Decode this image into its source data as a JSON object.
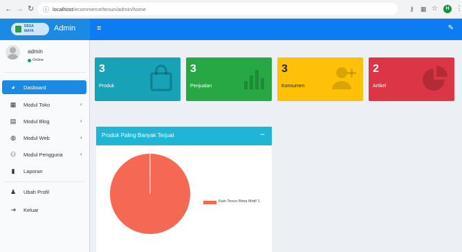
{
  "browser": {
    "url_host": "localhost",
    "url_path": "/ecommerce/tenun/admin/home",
    "profile_initial": "H"
  },
  "brand": {
    "logo_line1": "DESA",
    "logo_line2": "MAYA",
    "name": "Admin"
  },
  "user": {
    "name": "admin",
    "status": "Online"
  },
  "sidebar": {
    "items": [
      {
        "label": "Dasboard",
        "icon": "dashboard-icon"
      },
      {
        "label": "Modul Toko",
        "icon": "grid-icon"
      },
      {
        "label": "Modul Blog",
        "icon": "newspaper-icon"
      },
      {
        "label": "Modul Web",
        "icon": "globe-icon"
      },
      {
        "label": "Modul Pengguna",
        "icon": "users-icon"
      },
      {
        "label": "Laporan",
        "icon": "file-icon"
      },
      {
        "label": "Ubah Profil",
        "icon": "user-icon"
      },
      {
        "label": "Keluar",
        "icon": "sign-out-icon"
      }
    ]
  },
  "stats": [
    {
      "value": "3",
      "label": "Produk",
      "color": "#17a2b8",
      "icon": "shopping-bag-icon"
    },
    {
      "value": "3",
      "label": "Penjualan",
      "color": "#28a745",
      "icon": "bar-chart-icon"
    },
    {
      "value": "3",
      "label": "Konsumen",
      "color": "#ffc107",
      "icon": "user-plus-icon"
    },
    {
      "value": "2",
      "label": "Artikel",
      "color": "#dc3545",
      "icon": "pie-chart-icon"
    }
  ],
  "panel": {
    "title": "Produk Paling Banyak Terjual",
    "minus": "−"
  },
  "chart_data": {
    "type": "pie",
    "categories": [
      "Kain Tenun Bima Motif 1"
    ],
    "values": [
      3
    ],
    "colors": [
      "#f56954"
    ],
    "legend_position": "right"
  },
  "colors": {
    "topbar": "#0d7cf2",
    "logo_bg": "#1a8ae3",
    "active_nav": "#1a8ae3",
    "panel_header": "#1fb6d6",
    "body_bg": "#ecf0f5"
  }
}
